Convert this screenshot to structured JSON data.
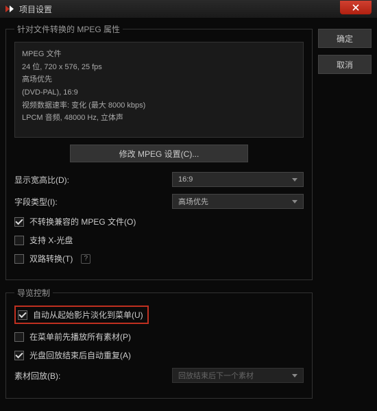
{
  "window": {
    "title": "项目设置"
  },
  "buttons": {
    "ok": "确定",
    "cancel": "取消",
    "modify": "修改 MPEG 设置(C)..."
  },
  "group1": {
    "legend": "针对文件转换的 MPEG 属性",
    "info": {
      "l1": "MPEG 文件",
      "l2": "24 位, 720 x 576, 25 fps",
      "l3": "高场优先",
      "l4": "(DVD-PAL), 16:9",
      "l5": "视频数据速率: 变化 (最大  8000 kbps)",
      "l6": "LPCM 音频, 48000 Hz, 立体声"
    },
    "aspect_label": "显示宽高比(D):",
    "aspect_value": "16:9",
    "field_label": "字段类型(I):",
    "field_value": "高场优先",
    "cb1": "不转换兼容的 MPEG 文件(O)",
    "cb2": "支持 X-光盘",
    "cb3": "双路转换(T)"
  },
  "group2": {
    "legend": "导览控制",
    "cb1": "自动从起始影片淡化到菜单(U)",
    "cb2": "在菜单前先播放所有素材(P)",
    "cb3": "光盘回放结束后自动重复(A)",
    "playback_label": "素材回放(B):",
    "playback_value": "回放结束后下一个素材"
  }
}
